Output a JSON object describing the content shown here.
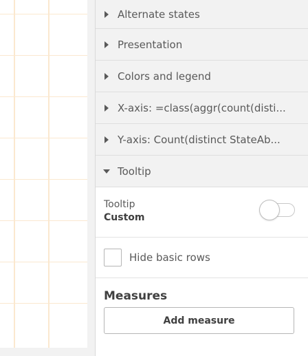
{
  "panel": {
    "sections": [
      {
        "label": "Alternate states",
        "expanded": false
      },
      {
        "label": "Presentation",
        "expanded": false
      },
      {
        "label": "Colors and legend",
        "expanded": false
      },
      {
        "label": "X-axis: =class(aggr(count(disti...",
        "expanded": false
      },
      {
        "label": "Y-axis: Count(distinct StateAb...",
        "expanded": false
      },
      {
        "label": "Tooltip",
        "expanded": true
      }
    ],
    "tooltip": {
      "label": "Tooltip",
      "value": "Custom",
      "toggle_on": false
    },
    "hide_basic_rows": {
      "label": "Hide basic rows",
      "checked": false
    },
    "measures": {
      "title": "Measures",
      "add_button_label": "Add measure"
    }
  },
  "colors": {
    "panel_header_bg": "#f2f2f2",
    "grid_line": "#fbe8cf",
    "text": "#595959"
  }
}
